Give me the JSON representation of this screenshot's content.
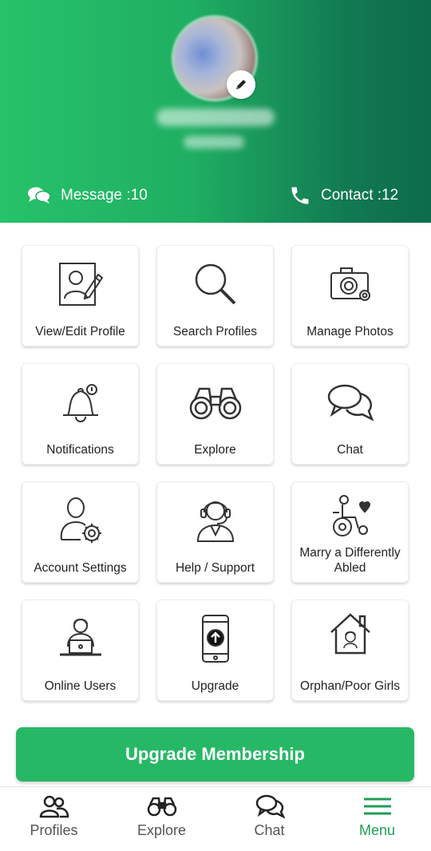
{
  "header": {
    "message_label": "Message :10",
    "contact_label": "Contact :12"
  },
  "tiles": [
    {
      "label": "View/Edit Profile",
      "icon": "edit-profile-icon"
    },
    {
      "label": "Search Profiles",
      "icon": "search-icon"
    },
    {
      "label": "Manage Photos",
      "icon": "camera-settings-icon"
    },
    {
      "label": "Notifications",
      "icon": "bell-icon"
    },
    {
      "label": "Explore",
      "icon": "binoculars-icon"
    },
    {
      "label": "Chat",
      "icon": "chat-bubbles-icon"
    },
    {
      "label": "Account Settings",
      "icon": "user-gear-icon"
    },
    {
      "label": "Help / Support",
      "icon": "headset-agent-icon"
    },
    {
      "label": "Marry a Differently Abled",
      "icon": "wheelchair-heart-icon"
    },
    {
      "label": "Online Users",
      "icon": "laptop-user-icon"
    },
    {
      "label": "Upgrade",
      "icon": "phone-upgrade-icon"
    },
    {
      "label": "Orphan/Poor Girls",
      "icon": "house-girl-icon"
    }
  ],
  "upgrade_button": "Upgrade Membership",
  "nav": [
    {
      "label": "Profiles",
      "icon": "users-icon"
    },
    {
      "label": "Explore",
      "icon": "binoculars-icon"
    },
    {
      "label": "Chat",
      "icon": "chat-bubbles-icon"
    },
    {
      "label": "Menu",
      "icon": "menu-icon",
      "active": true
    }
  ],
  "colors": {
    "accent": "#27b866",
    "header_start": "#27c26a",
    "header_end": "#0c6b4c",
    "active_nav": "#1f9e57"
  }
}
